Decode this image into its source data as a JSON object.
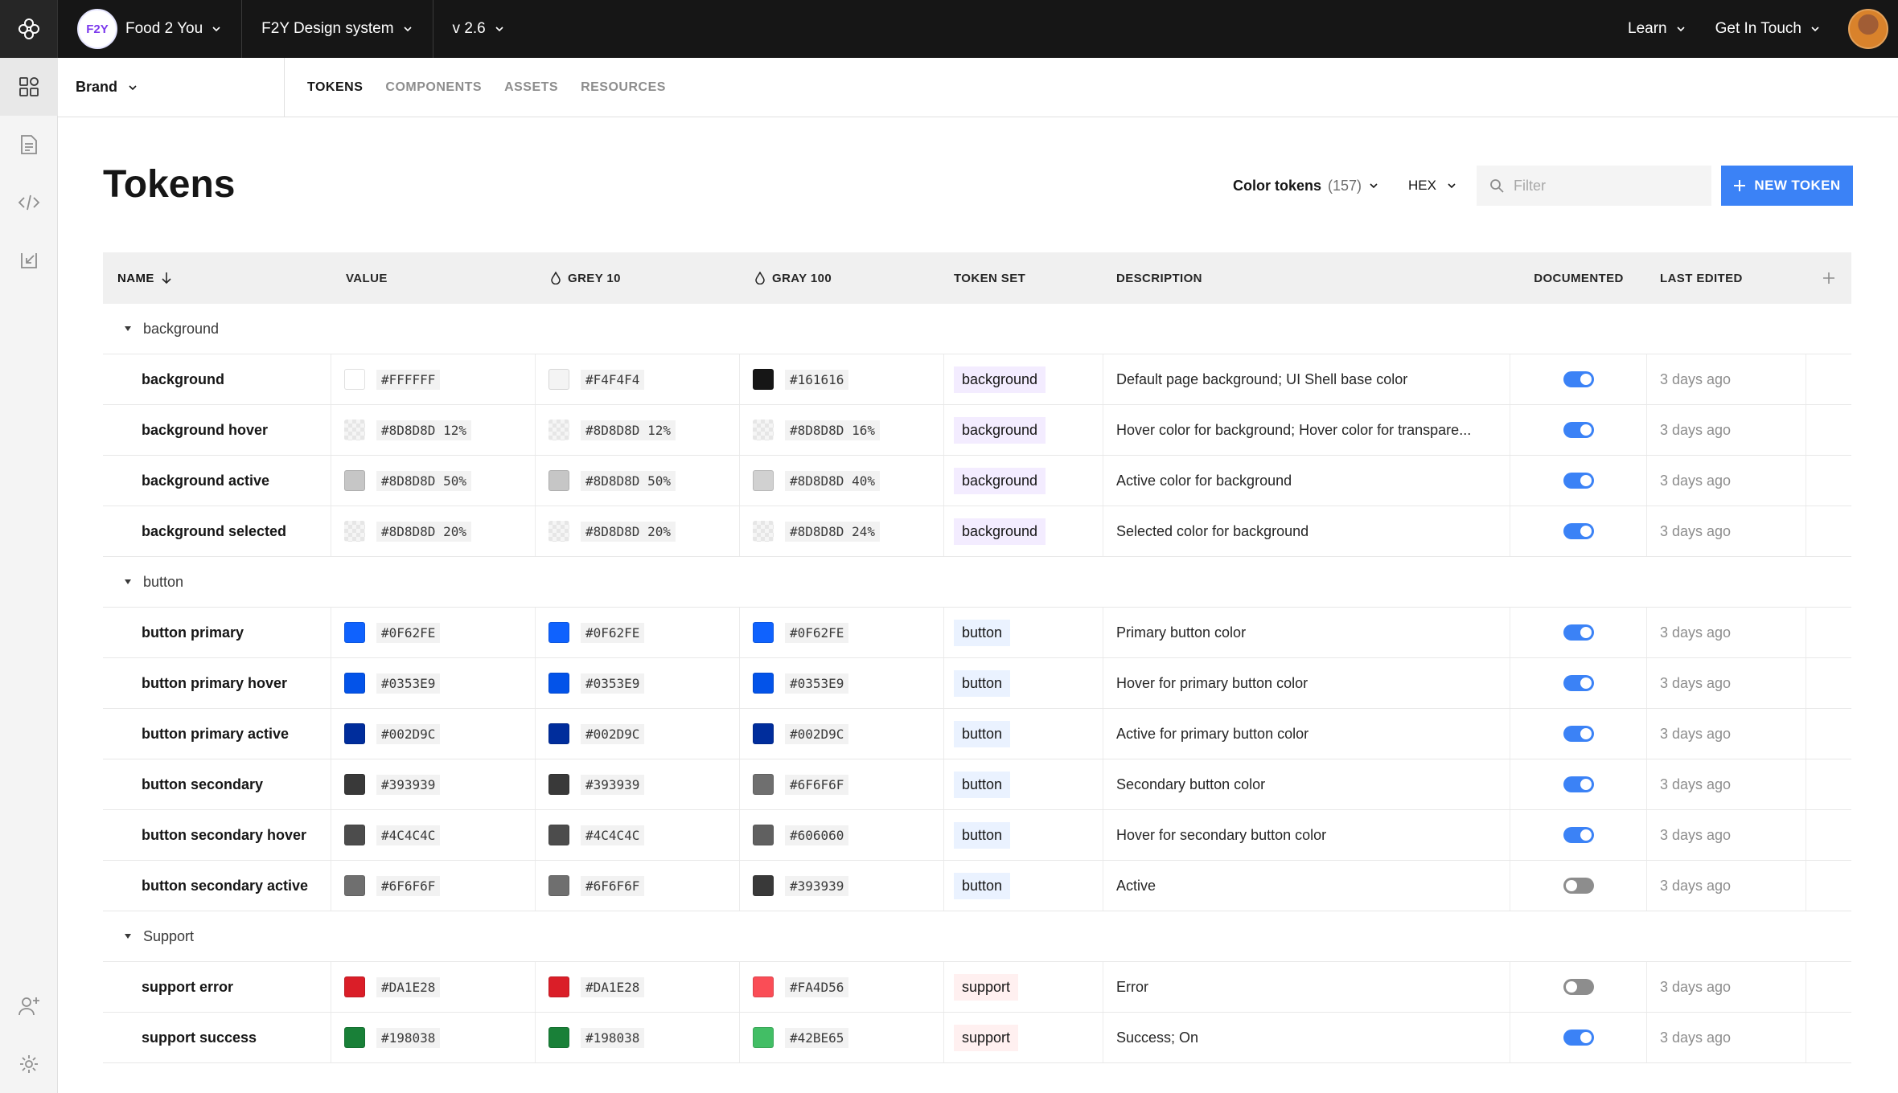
{
  "topbar": {
    "org_badge": "F2Y",
    "org_name": "Food 2 You",
    "design_system": "F2Y Design system",
    "version": "v 2.6",
    "learn": "Learn",
    "get_in_touch": "Get In Touch"
  },
  "subheader": {
    "brand": "Brand",
    "tabs": [
      "TOKENS",
      "COMPONENTS",
      "ASSETS",
      "RESOURCES"
    ]
  },
  "page": {
    "title": "Tokens",
    "color_tokens_label": "Color tokens",
    "color_tokens_count": "(157)",
    "format": "HEX",
    "filter_placeholder": "Filter",
    "new_token": "NEW TOKEN"
  },
  "table": {
    "headers": {
      "name": "NAME",
      "value": "VALUE",
      "grey10": "GREY 10",
      "gray100": "GRAY 100",
      "token_set": "TOKEN SET",
      "description": "DESCRIPTION",
      "documented": "DOCUMENTED",
      "last_edited": "LAST EDITED"
    },
    "groups": [
      {
        "label": "background",
        "tag_bg": "#f3ecff",
        "rows": [
          {
            "name": "background",
            "v1": "#FFFFFF",
            "s1": "#FFFFFF",
            "v2": "#F4F4F4",
            "s2": "#F4F4F4",
            "v3": "#161616",
            "s3": "#161616",
            "set": "background",
            "desc": "Default page background; UI Shell base color",
            "doc": true,
            "edited": "3 days ago"
          },
          {
            "name": "background hover",
            "v1": "#8D8D8D 12%",
            "s1": "checker",
            "v2": "#8D8D8D 12%",
            "s2": "checker",
            "v3": "#8D8D8D 16%",
            "s3": "checker",
            "set": "background",
            "desc": "Hover color for background; Hover color for transpare...",
            "doc": true,
            "edited": "3 days ago"
          },
          {
            "name": "background active",
            "v1": "#8D8D8D 50%",
            "s1": "#c6c6c6",
            "v2": "#8D8D8D 50%",
            "s2": "#c6c6c6",
            "v3": "#8D8D8D 40%",
            "s3": "#d1d1d1",
            "set": "background",
            "desc": "Active color for background",
            "doc": true,
            "edited": "3 days ago"
          },
          {
            "name": "background selected",
            "v1": "#8D8D8D 20%",
            "s1": "checker",
            "v2": "#8D8D8D 20%",
            "s2": "checker",
            "v3": "#8D8D8D 24%",
            "s3": "checker",
            "set": "background",
            "desc": "Selected color for background",
            "doc": true,
            "edited": "3 days ago"
          }
        ]
      },
      {
        "label": "button",
        "tag_bg": "#eaf2ff",
        "rows": [
          {
            "name": "button primary",
            "v1": "#0F62FE",
            "s1": "#0F62FE",
            "v2": "#0F62FE",
            "s2": "#0F62FE",
            "v3": "#0F62FE",
            "s3": "#0F62FE",
            "set": "button",
            "desc": "Primary button color",
            "doc": true,
            "edited": "3 days ago"
          },
          {
            "name": "button primary hover",
            "v1": "#0353E9",
            "s1": "#0353E9",
            "v2": "#0353E9",
            "s2": "#0353E9",
            "v3": "#0353E9",
            "s3": "#0353E9",
            "set": "button",
            "desc": "Hover for primary button color",
            "doc": true,
            "edited": "3 days ago"
          },
          {
            "name": "button primary active",
            "v1": "#002D9C",
            "s1": "#002D9C",
            "v2": "#002D9C",
            "s2": "#002D9C",
            "v3": "#002D9C",
            "s3": "#002D9C",
            "set": "button",
            "desc": "Active for primary button color",
            "doc": true,
            "edited": "3 days ago"
          },
          {
            "name": "button secondary",
            "v1": "#393939",
            "s1": "#393939",
            "v2": "#393939",
            "s2": "#393939",
            "v3": "#6F6F6F",
            "s3": "#6F6F6F",
            "set": "button",
            "desc": "Secondary button color",
            "doc": true,
            "edited": "3 days ago"
          },
          {
            "name": "button secondary hover",
            "v1": "#4C4C4C",
            "s1": "#4C4C4C",
            "v2": "#4C4C4C",
            "s2": "#4C4C4C",
            "v3": "#606060",
            "s3": "#606060",
            "set": "button",
            "desc": "Hover for secondary button color",
            "doc": true,
            "edited": "3 days ago"
          },
          {
            "name": "button secondary active",
            "v1": "#6F6F6F",
            "s1": "#6F6F6F",
            "v2": "#6F6F6F",
            "s2": "#6F6F6F",
            "v3": "#393939",
            "s3": "#393939",
            "set": "button",
            "desc": "Active",
            "doc": false,
            "edited": "3 days ago"
          }
        ]
      },
      {
        "label": "Support",
        "tag_bg": "#fff0f0",
        "rows": [
          {
            "name": "support error",
            "v1": "#DA1E28",
            "s1": "#DA1E28",
            "v2": "#DA1E28",
            "s2": "#DA1E28",
            "v3": "#FA4D56",
            "s3": "#FA4D56",
            "set": "support",
            "desc": "Error",
            "doc": false,
            "edited": "3 days ago"
          },
          {
            "name": "support success",
            "v1": "#198038",
            "s1": "#198038",
            "v2": "#198038",
            "s2": "#198038",
            "v3": "#42BE65",
            "s3": "#42BE65",
            "set": "support",
            "desc": "Success; On",
            "doc": true,
            "edited": "3 days ago"
          }
        ]
      }
    ]
  },
  "colors": {
    "accent": "#3b82f6",
    "topbar_bg": "#161616",
    "rail_bg": "#f4f4f4"
  }
}
